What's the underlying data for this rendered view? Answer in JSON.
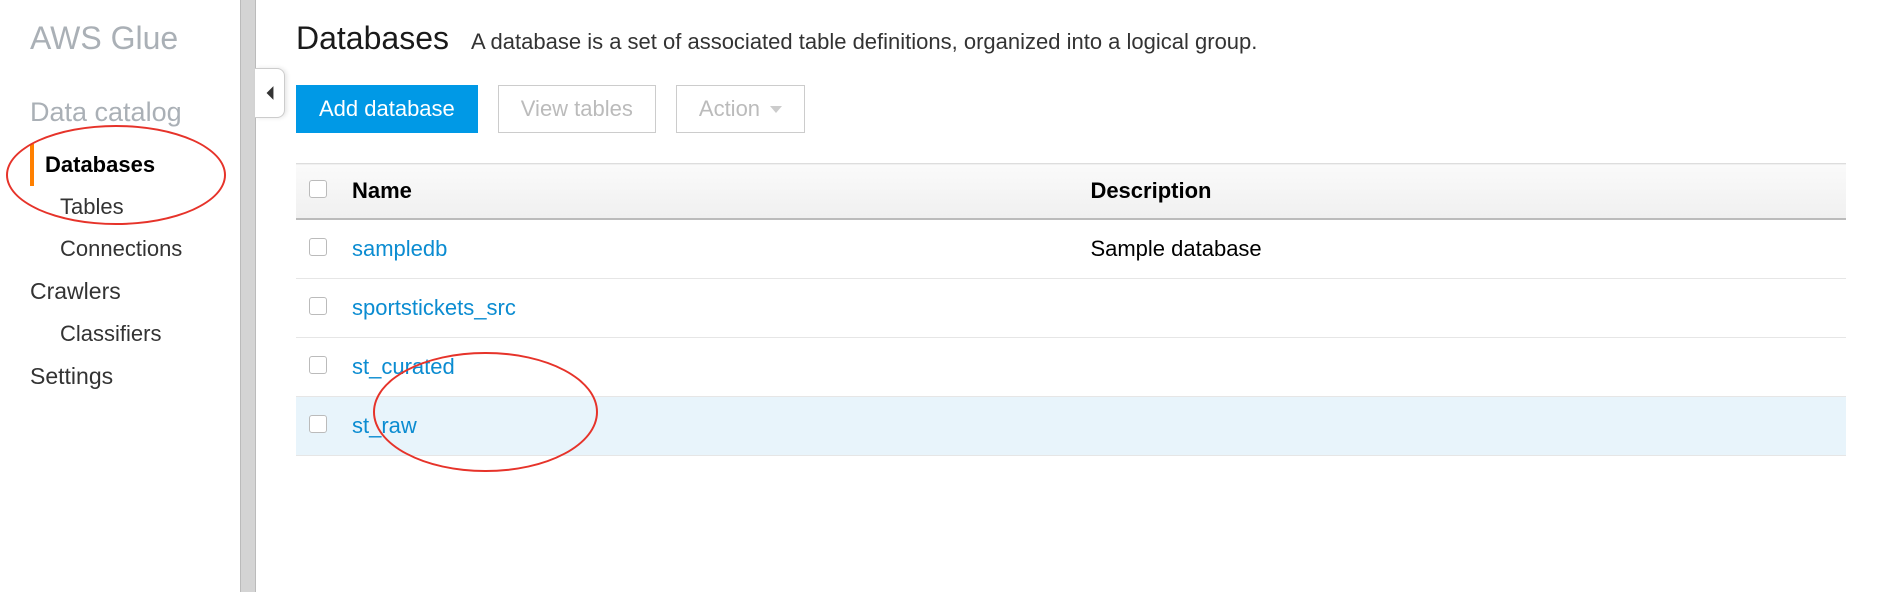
{
  "app_title": "AWS Glue",
  "sidebar": {
    "section1_label": "Data catalog",
    "items": [
      {
        "label": "Databases",
        "active": true,
        "sub": false
      },
      {
        "label": "Tables",
        "active": false,
        "sub": true
      },
      {
        "label": "Connections",
        "active": false,
        "sub": true
      }
    ],
    "crawlers_label": "Crawlers",
    "classifiers_label": "Classifiers",
    "settings_label": "Settings"
  },
  "header": {
    "title": "Databases",
    "description": "A database is a set of associated table definitions, organized into a logical group."
  },
  "toolbar": {
    "add_label": "Add database",
    "view_tables_label": "View tables",
    "action_label": "Action"
  },
  "table": {
    "col_name": "Name",
    "col_description": "Description",
    "rows": [
      {
        "name": "sampledb",
        "description": "Sample database",
        "highlight": false
      },
      {
        "name": "sportstickets_src",
        "description": "",
        "highlight": false
      },
      {
        "name": "st_curated",
        "description": "",
        "highlight": false
      },
      {
        "name": "st_raw",
        "description": "",
        "highlight": true
      }
    ]
  }
}
